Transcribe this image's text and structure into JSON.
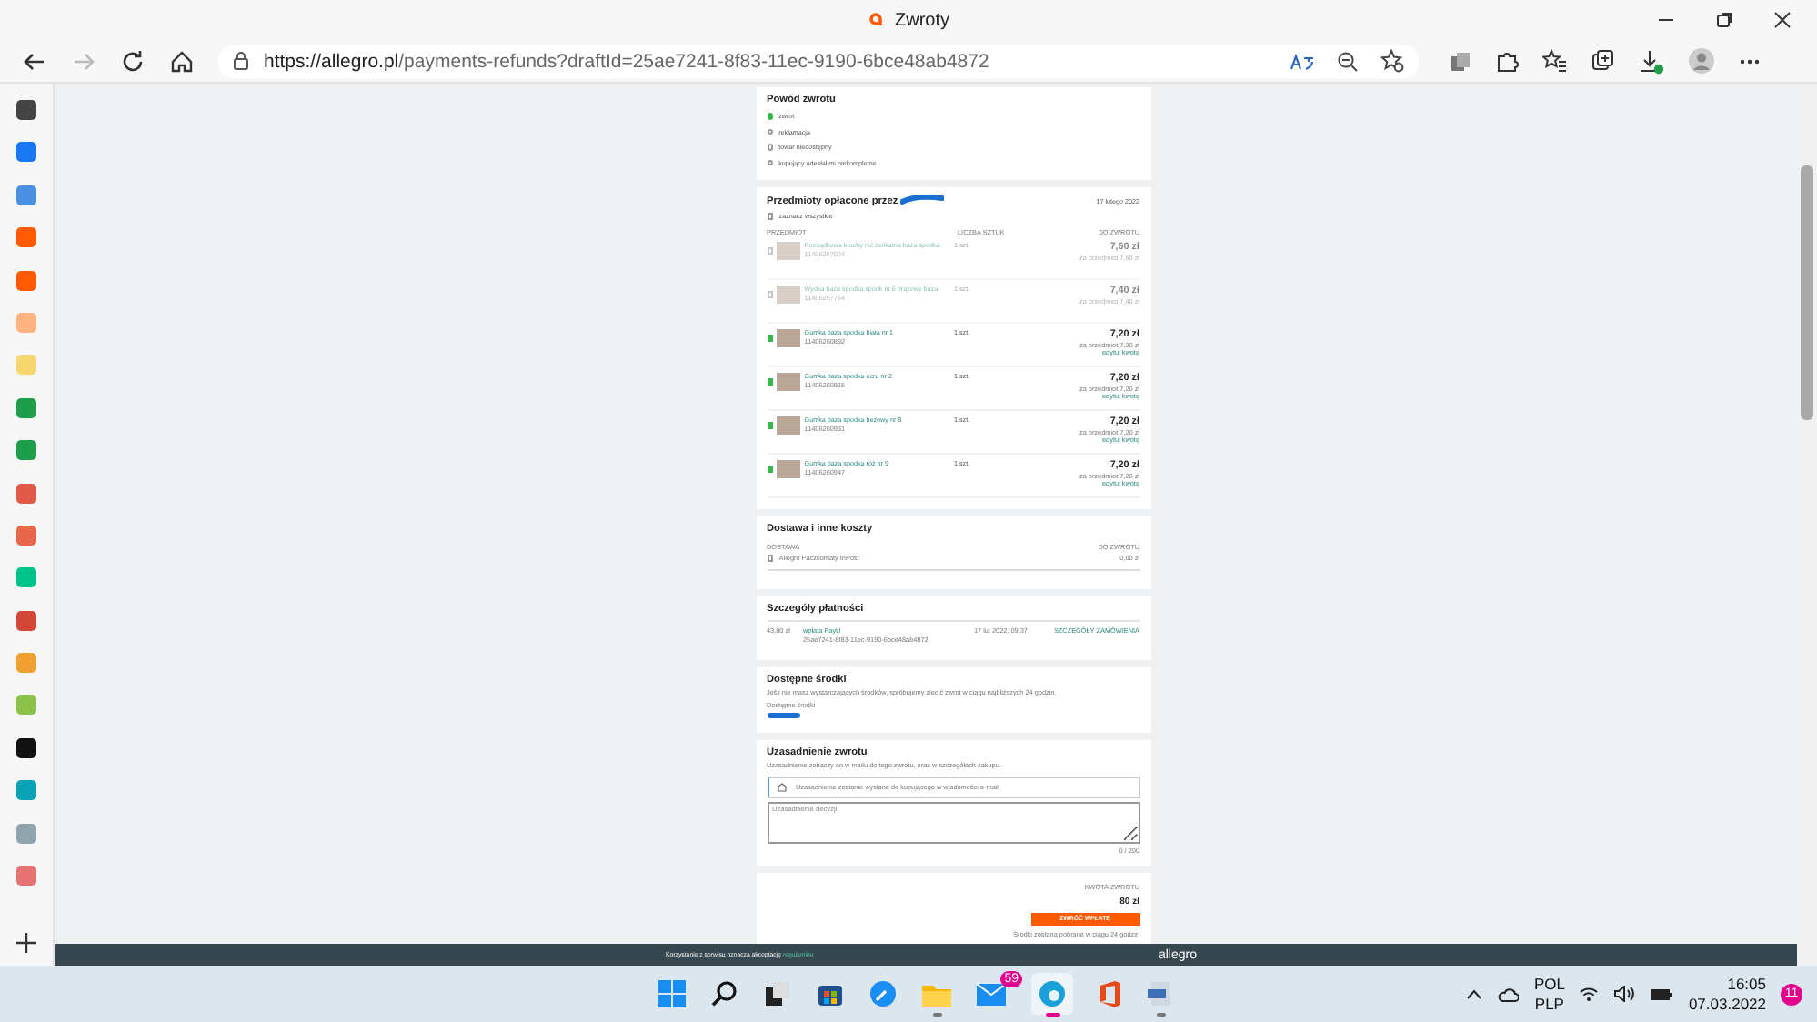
{
  "browser": {
    "tab_title": "Zwroty",
    "url_host": "https://allegro.pl",
    "url_path": "/payments-refunds?draftId=25ae7241-8f83-11ec-9190-6bce48ab4872"
  },
  "return_reason": {
    "title": "Powód zwrotu",
    "options": [
      {
        "label": "zwrot",
        "selected": true
      },
      {
        "label": "reklamacja",
        "selected": false
      },
      {
        "label": "towar niedostępny",
        "selected": false
      },
      {
        "label": "kupujący odesłał mi niekompletne",
        "selected": false
      }
    ]
  },
  "items": {
    "title": "Przedmioty opłacone przez",
    "date": "17 lutego 2022",
    "select_all": {
      "label": "zaznacz wszystkie",
      "checked": false
    },
    "columns": [
      "PRZEDMIOT",
      "LICZBA SZTUK",
      "DO ZWROTU"
    ],
    "rows": [
      {
        "name": "Rozsądkowa kruchy nić delikatna baza spodka",
        "id": "11406257024",
        "quantity": "1 szt.",
        "price": "7,60 zł",
        "unit_price": "za przedmiot 7,60 zł",
        "checked": false
      },
      {
        "name": "Wydka baza spodka spodk nr 6 brązowy baza",
        "id": "11406257754",
        "quantity": "1 szt.",
        "price": "7,40 zł",
        "unit_price": "za przedmiot 7,40 zł",
        "checked": false
      },
      {
        "name": "Gumka baza spodka biała nr 1",
        "id": "11406260892",
        "quantity": "1 szt.",
        "price": "7,20 zł",
        "unit_price": "za przedmiot 7,20 zł",
        "edit_link": "edytuj kwotę",
        "checked": true
      },
      {
        "name": "Gumka baza spodka ecru nr 2",
        "id": "11406260915",
        "quantity": "1 szt.",
        "price": "7,20 zł",
        "unit_price": "za przedmiot 7,20 zł",
        "edit_link": "edytuj kwotę",
        "checked": true
      },
      {
        "name": "Gumka baza spodka beżowy nr 8",
        "id": "11406260931",
        "quantity": "1 szt.",
        "price": "7,20 zł",
        "unit_price": "za przedmiot 7,20 zł",
        "edit_link": "edytuj kwotę",
        "checked": true
      },
      {
        "name": "Gumka baza spodka róż nr 9",
        "id": "11406260947",
        "quantity": "1 szt.",
        "price": "7,20 zł",
        "unit_price": "za przedmiot 7,20 zł",
        "edit_link": "edytuj kwotę",
        "checked": true
      }
    ]
  },
  "delivery": {
    "title": "Dostawa i inne koszty",
    "columns": [
      "DOSTAWA",
      "DO ZWROTU"
    ],
    "rows": [
      {
        "name": "Allegro Paczkomaty InPost",
        "amount": "0,00 zł",
        "checked": false
      }
    ]
  },
  "payment": {
    "title": "Szczegóły płatności",
    "amount": "43,80 zł",
    "method": "wpłata PayU",
    "id": "25ae7241-8f83-11ec-9190-6bce48ab4872",
    "date": "17 lut 2022, 09:37",
    "link": "SZCZEGÓŁY ZAMÓWIENIA"
  },
  "funds": {
    "title": "Dostępne środki",
    "text": "Jeśli nie masz wystarczających środków, spróbujemy zlecić zwrot w ciągu najbliższych 24 godzin.",
    "label": "Dostępne środki"
  },
  "justification": {
    "title": "Uzasadnienie zwrotu",
    "text": "Uzasadnienie zobaczy on w mailu do tego zwrotu, oraz w szczegółach zakupu.",
    "info": "Uzasadnienie zostanie wysłane do kupującego w wiadomości e-mail",
    "placeholder": "Uzasadnienie decyzji",
    "counter": "0 / 200"
  },
  "summary": {
    "label": "KWOTA ZWROTU",
    "amount": "80 zł",
    "button": "ZWRÓĆ WPŁATĘ",
    "note": "Środki zostaną pobrane w ciągu 24 godzin"
  },
  "footer": {
    "text": "Korzystanie z serwisu oznacza akceptację",
    "link": "regulaminu",
    "logo": "allegro"
  },
  "taskbar": {
    "mail_badge": "59",
    "language": "POL",
    "layout": "PLP",
    "time": "16:05",
    "date": "07.03.2022",
    "notifications": "11"
  }
}
